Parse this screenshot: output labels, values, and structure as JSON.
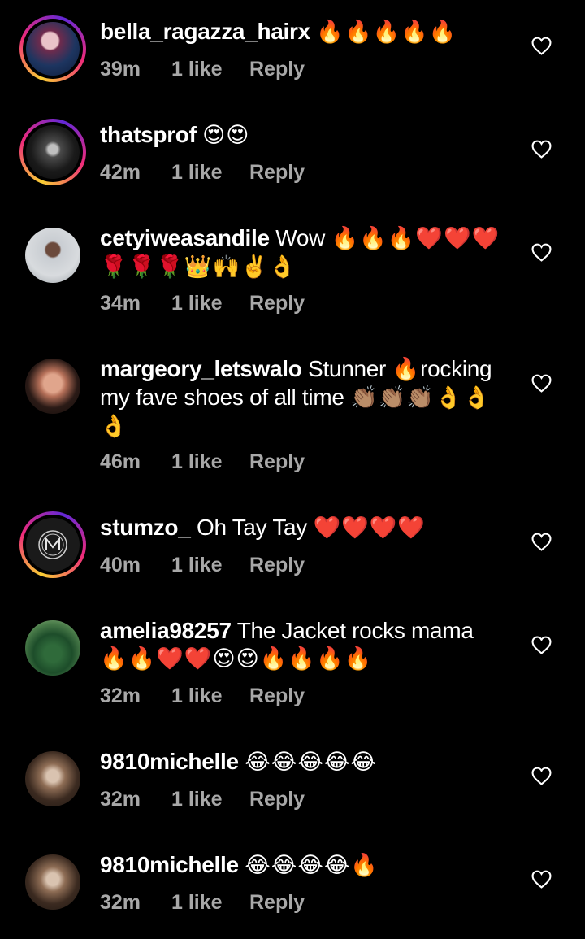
{
  "comments": [
    {
      "username": "bella_ragazza_hairx",
      "text": "",
      "emoji": "🔥🔥🔥🔥🔥",
      "time": "39m",
      "likes": "1 like",
      "reply": "Reply",
      "story_ring": true
    },
    {
      "username": "thatsprof",
      "text": "",
      "emoji": "😍😍",
      "time": "42m",
      "likes": "1 like",
      "reply": "Reply",
      "story_ring": true
    },
    {
      "username": "cetyiweasandile",
      "text": "Wow",
      "emoji": "🔥🔥🔥❤️❤️❤️🌹🌹🌹👑🙌✌️👌",
      "time": "34m",
      "likes": "1 like",
      "reply": "Reply",
      "story_ring": false
    },
    {
      "username": "margeory_letswalo",
      "text": "Stunner",
      "emoji_mid": "🔥",
      "text2": "rocking my fave shoes of all time",
      "emoji": "👏🏽👏🏽👏🏽👌👌👌",
      "time": "46m",
      "likes": "1 like",
      "reply": "Reply",
      "story_ring": false
    },
    {
      "username": "stumzo_",
      "text": "Oh Tay Tay",
      "emoji": "❤️❤️❤️❤️",
      "time": "40m",
      "likes": "1 like",
      "reply": "Reply",
      "story_ring": true
    },
    {
      "username": "amelia98257",
      "text": "The Jacket rocks mama",
      "emoji": "🔥🔥❤️❤️😍😍🔥🔥🔥🔥",
      "time": "32m",
      "likes": "1 like",
      "reply": "Reply",
      "story_ring": false
    },
    {
      "username": "9810michelle",
      "text": "",
      "emoji": "😂😂😂😂😂",
      "time": "32m",
      "likes": "1 like",
      "reply": "Reply",
      "story_ring": false
    },
    {
      "username": "9810michelle",
      "text": "",
      "emoji": "😂😂😂😂🔥",
      "time": "32m",
      "likes": "1 like",
      "reply": "Reply",
      "story_ring": false
    }
  ],
  "icons": {
    "like": "heart-outline-icon"
  },
  "colors": {
    "background": "#000000",
    "text": "#ffffff",
    "meta_text": "#a8a8a8",
    "story_ring_gradient": [
      "#f9ce34",
      "#ee2a7b",
      "#6228d7"
    ]
  }
}
